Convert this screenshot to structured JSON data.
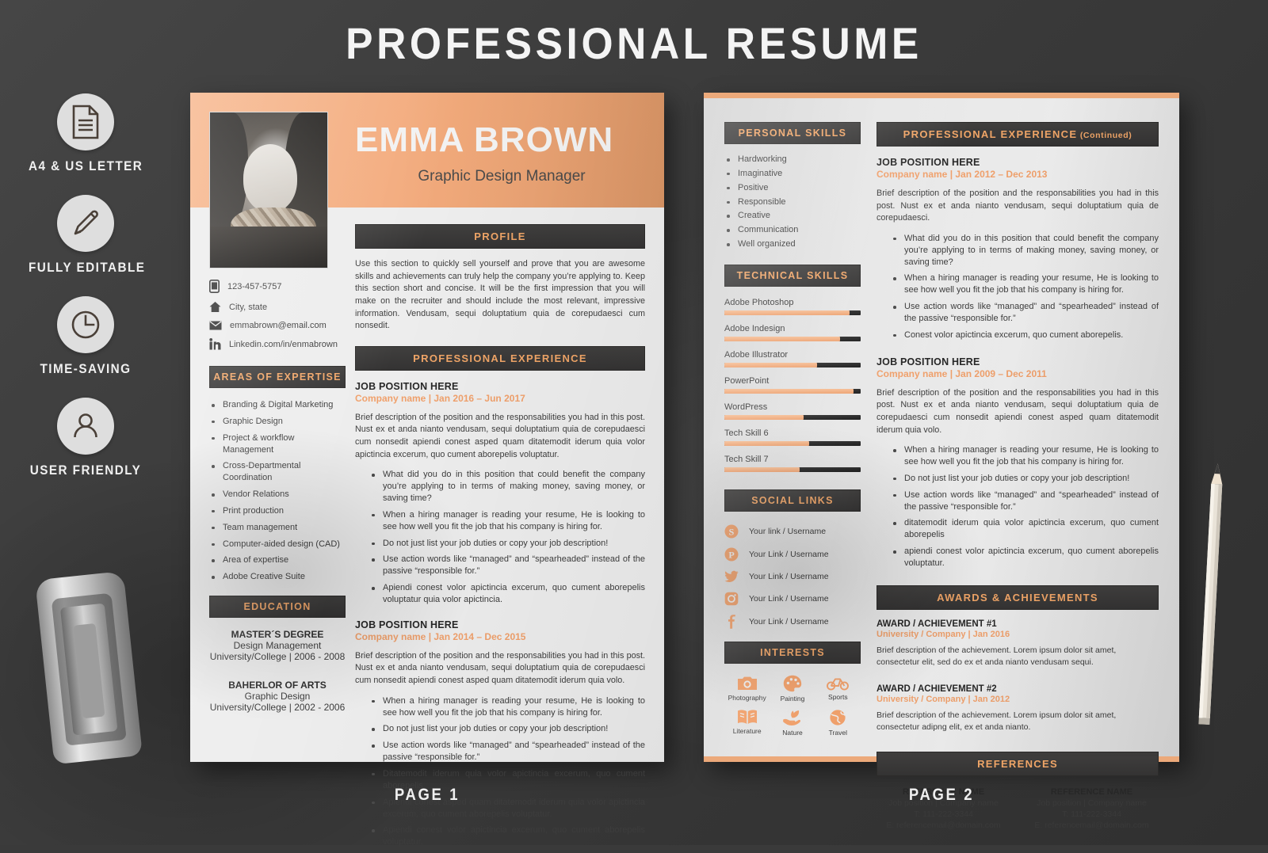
{
  "header": {
    "title": "PROFESSIONAL RESUME"
  },
  "features": [
    {
      "icon": "document-icon",
      "label": "A4 & US LETTER"
    },
    {
      "icon": "pencil-icon",
      "label": "FULLY EDITABLE"
    },
    {
      "icon": "clock-icon",
      "label": "TIME-SAVING"
    },
    {
      "icon": "user-icon",
      "label": "USER FRIENDLY"
    }
  ],
  "page_labels": {
    "page1": "PAGE 1",
    "page2": "PAGE 2"
  },
  "colors": {
    "accent": "#eda271",
    "accent_text": "#f0a567",
    "bar_dark": "#383736",
    "paper": "#ededed",
    "backdrop": "#3a3a3a"
  },
  "page1": {
    "name": "EMMA BROWN",
    "role": "Graphic Design Manager",
    "contacts": [
      {
        "icon": "phone-icon",
        "text": "123-457-5757"
      },
      {
        "icon": "home-icon",
        "text": "City, state"
      },
      {
        "icon": "envelope-icon",
        "text": "emmabrown@email.com"
      },
      {
        "icon": "linkedin-icon",
        "text": "Linkedin.com/in/enmabrown"
      }
    ],
    "expertise": {
      "heading": "AREAS OF EXPERTISE",
      "items": [
        "Branding & Digital Marketing",
        "Graphic Design",
        "Project & workflow Management",
        "Cross-Departmental Coordination",
        "Vendor Relations",
        "Print production",
        "Team management",
        "Computer-aided design (CAD)",
        "Area of expertise",
        "Adobe Creative Suite"
      ]
    },
    "education": {
      "heading": "EDUCATION",
      "entries": [
        {
          "degree": "MASTER´S DEGREE",
          "field": "Design Management",
          "school": "University/College | 2006 - 2008"
        },
        {
          "degree": "BAHERLOR OF ARTS",
          "field": "Graphic Design",
          "school": "University/College | 2002 - 2006"
        }
      ]
    },
    "profile": {
      "heading": "PROFILE",
      "text": "Use this section to quickly sell yourself and prove that you are awesome skills and achievements can truly help the company you’re applying to. Keep this section short and concise.  It will be the first impression that you will make on the recruiter and should include the most relevant, impressive information. Vendusam, sequi doluptatium quia de corepudaesci cum nonsedit."
    },
    "experience": {
      "heading": "PROFESSIONAL EXPERIENCE",
      "jobs": [
        {
          "title": "JOB POSITION HERE",
          "meta": "Company name | Jan 2016 – Jun 2017",
          "desc": "Brief description of the position and the responsabilities you had in this post. Nust ex et anda nianto vendusam, sequi doluptatium quia de corepudaesci cum nonsedit apiendi conest asped quam ditatemodit iderum quia volor apictincia excerum, quo cument aborepelis voluptatur.",
          "bullets": [
            "What did you do in this position that could benefit the company you’re applying to in terms of making money, saving money, or saving time?",
            "When a hiring manager is reading your resume, He is looking to see how well you fit the job that his company is hiring for.",
            "Do not just list your job duties or copy your job description!",
            "Use action words like “managed” and “spearheaded” instead of the passive “responsible for.”",
            "Apiendi conest volor apictincia excerum, quo cument aborepelis voluptatur quia volor apictincia."
          ]
        },
        {
          "title": "JOB POSITION HERE",
          "meta": "Company name | Jan 2014 – Dec 2015",
          "desc": "Brief description of the position and the responsabilities you had in this post. Nust ex et anda nianto vendusam, sequi doluptatium quia de corepudaesci cum nonsedit apiendi conest asped quam ditatemodit iderum quia volo.",
          "bullets": [
            "When a hiring manager is reading your resume, He is looking to see how well you fit the job that his company is hiring for.",
            "Do not just list your job duties or copy your job description!",
            "Use action words like “managed” and “spearheaded” instead of the passive “responsible for.”",
            "Ditatemodit iderum quia volor apictincia excerum, quo cument aborepelis",
            "Apiendi conest asped quam ditatemodit iderum quia volor apictincia excerum, quo cument aborepelis voluptatur.",
            "Apiendi conest volor apictincia excerum, quo cument aborepelis voluptatur."
          ]
        }
      ]
    }
  },
  "page2": {
    "personal_skills": {
      "heading": "PERSONAL SKILLS",
      "items": [
        "Hardworking",
        "Imaginative",
        "Positive",
        "Responsible",
        "Creative",
        "Communication",
        "Well organized"
      ]
    },
    "technical_skills": {
      "heading": "TECHNICAL SKILLS",
      "items": [
        {
          "name": "Adobe Photoshop",
          "level": 92
        },
        {
          "name": "Adobe Indesign",
          "level": 85
        },
        {
          "name": "Adobe Illustrator",
          "level": 68
        },
        {
          "name": "PowerPoint",
          "level": 95
        },
        {
          "name": "WordPress",
          "level": 58
        },
        {
          "name": "Tech Skill 6",
          "level": 62
        },
        {
          "name": "Tech Skill 7",
          "level": 55
        }
      ]
    },
    "social_links": {
      "heading": "SOCIAL LINKS",
      "items": [
        {
          "icon": "skype-icon",
          "text": "Your link / Username"
        },
        {
          "icon": "pinterest-icon",
          "text": "Your Link / Username"
        },
        {
          "icon": "twitter-icon",
          "text": "Your Link / Username"
        },
        {
          "icon": "instagram-icon",
          "text": "Your Link / Username"
        },
        {
          "icon": "facebook-icon",
          "text": "Your Link / Username"
        }
      ]
    },
    "interests": {
      "heading": "INTERESTS",
      "items": [
        {
          "icon": "camera-icon",
          "label": "Photography"
        },
        {
          "icon": "palette-icon",
          "label": "Painting"
        },
        {
          "icon": "bicycle-icon",
          "label": "Sports"
        },
        {
          "icon": "book-icon",
          "label": "Literature"
        },
        {
          "icon": "plant-hand-icon",
          "label": "Nature"
        },
        {
          "icon": "globe-icon",
          "label": "Travel"
        }
      ]
    },
    "experience": {
      "heading": "PROFESSIONAL EXPERIENCE",
      "heading_suffix": " (Continued)",
      "jobs": [
        {
          "title": "JOB POSITION HERE",
          "meta": "Company name | Jan 2012 – Dec 2013",
          "desc": "Brief description of the position and the responsabilities you had in this post. Nust ex et anda nianto vendusam, sequi doluptatium quia de corepudaesci.",
          "bullets": [
            "What did you do in this position that could benefit the company you’re applying to in terms of making money, saving money, or saving time?",
            "When a hiring manager is reading your resume, He is looking to see how well you fit the job that his company is hiring for.",
            "Use action words like “managed” and “spearheaded” instead of the passive “responsible for.”",
            "Conest volor apictincia excerum, quo cument aborepelis."
          ]
        },
        {
          "title": "JOB POSITION HERE",
          "meta": "Company name | Jan 2009 – Dec 2011",
          "desc": "Brief description of the position and the responsabilities you had in this post. Nust ex et anda nianto vendusam, sequi doluptatium quia de corepudaesci cum nonsedit apiendi conest asped quam ditatemodit iderum quia volo.",
          "bullets": [
            "When a hiring manager is reading your resume, He is looking to see how well you fit the job that his company is hiring for.",
            "Do not just list your job duties or copy your job description!",
            "Use action words like “managed” and “spearheaded” instead of the passive “responsible for.”",
            "ditatemodit iderum quia volor apictincia excerum, quo cument aborepelis",
            "apiendi conest volor apictincia excerum, quo cument aborepelis voluptatur."
          ]
        }
      ]
    },
    "awards": {
      "heading": "AWARDS & ACHIEVEMENTS",
      "items": [
        {
          "title": "AWARD / ACHIEVEMENT #1",
          "meta": "University / Company | Jan 2016",
          "desc": "Brief description of the achievement. Lorem ipsum dolor sit amet, consectetur elit, sed do ex et anda nianto vendusam sequi."
        },
        {
          "title": "AWARD / ACHIEVEMENT #2",
          "meta": "University / Company | Jan 2012",
          "desc": "Brief description of the achievement. Lorem ipsum dolor sit amet, consectetur adipng elit, ex et anda nianto."
        }
      ]
    },
    "references": {
      "heading": "REFERENCES",
      "items": [
        {
          "name": "REFERENCE NAME",
          "position": "Job position | Company name",
          "phone": "T: 111-222-3344",
          "email": "E: referencemail@domain.com"
        },
        {
          "name": "REFERENCE NAME",
          "position": "Job position | Company name",
          "phone": "T: 111-222-3344",
          "email": "E: referencemail@domain.com"
        }
      ]
    }
  }
}
